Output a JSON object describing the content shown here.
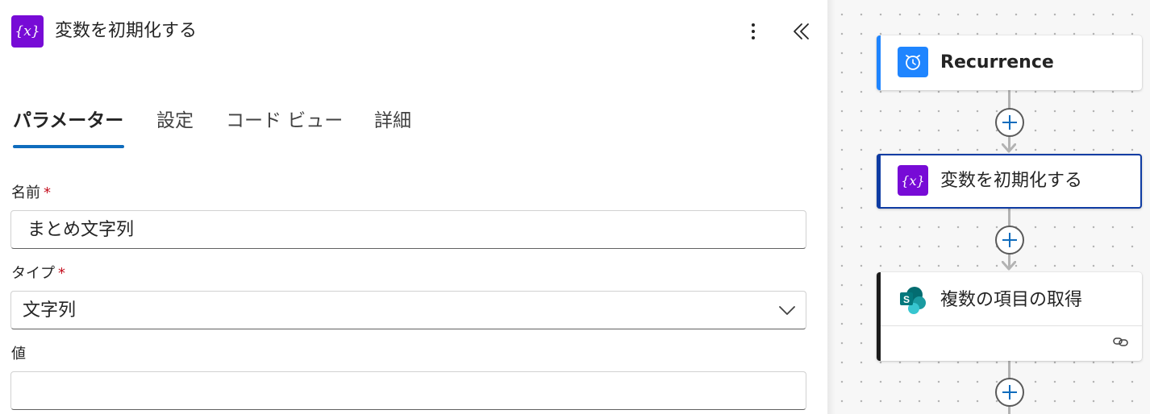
{
  "panel": {
    "icon": "variable-icon",
    "icon_text": "{x}",
    "title": "変数を初期化する",
    "more_icon": "more-vertical-icon",
    "collapse_icon": "double-chevron-left-icon"
  },
  "tabs": [
    {
      "label": "パラメーター",
      "active": true
    },
    {
      "label": "設定",
      "active": false
    },
    {
      "label": "コード ビュー",
      "active": false
    },
    {
      "label": "詳細",
      "active": false
    }
  ],
  "fields": {
    "name": {
      "label": "名前",
      "required_mark": "*",
      "value": "まとめ文字列"
    },
    "type": {
      "label": "タイプ",
      "required_mark": "*",
      "value": "文字列",
      "icon": "chevron-down-icon"
    },
    "value": {
      "label": "値",
      "value": ""
    }
  },
  "flow": {
    "nodes": [
      {
        "title": "Recurrence",
        "icon": "alarm-clock-icon",
        "accent": "#1f85ff"
      },
      {
        "title": "変数を初期化する",
        "icon": "variable-icon",
        "icon_text": "{x}",
        "accent": "#0f3ca3",
        "selected": true
      },
      {
        "title": "複数の項目の取得",
        "icon": "sharepoint-icon",
        "icon_text": "S",
        "accent": "#1b1b1b",
        "footer_icon": "link-icon"
      }
    ],
    "add_step_icon": "plus-icon"
  },
  "colors": {
    "variable_purple": "#770bd6",
    "tab_underline": "#0f6cbd",
    "required_red": "#c50f1f"
  }
}
